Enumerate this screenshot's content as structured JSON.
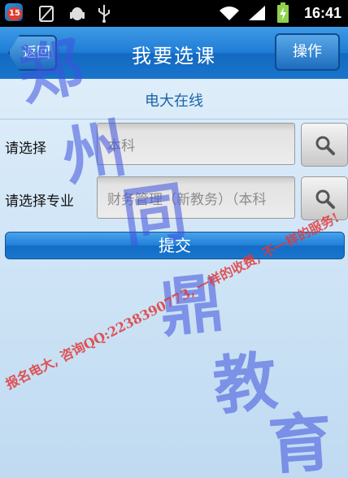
{
  "status_bar": {
    "notification_count": "15",
    "time": "16:41",
    "icons": [
      "app-notification-icon",
      "no-sim-icon",
      "android-debug-icon",
      "usb-icon",
      "wifi-icon",
      "signal-icon",
      "battery-charging-icon"
    ]
  },
  "header": {
    "back_label": "返回",
    "title": "我要选课",
    "action_label": "操作"
  },
  "subtitle": "电大在线",
  "form": {
    "row1": {
      "label": "请选择",
      "value": "本科"
    },
    "row2": {
      "label": "请选择专业",
      "value": "财务管理（新教务）（本科"
    },
    "submit_label": "提交"
  },
  "watermark": {
    "chars": [
      "郑",
      "州",
      "同",
      "鼎",
      "教",
      "育"
    ],
    "line": "报名电大, 咨询QQ:2238390773, 一样的收费, 不一样的服务!"
  },
  "colors": {
    "header_blue": "#1f7cd6",
    "subtitle_blue": "#1c63a8",
    "watermark_blue": "#3e52dc",
    "watermark_red": "#e23838"
  }
}
